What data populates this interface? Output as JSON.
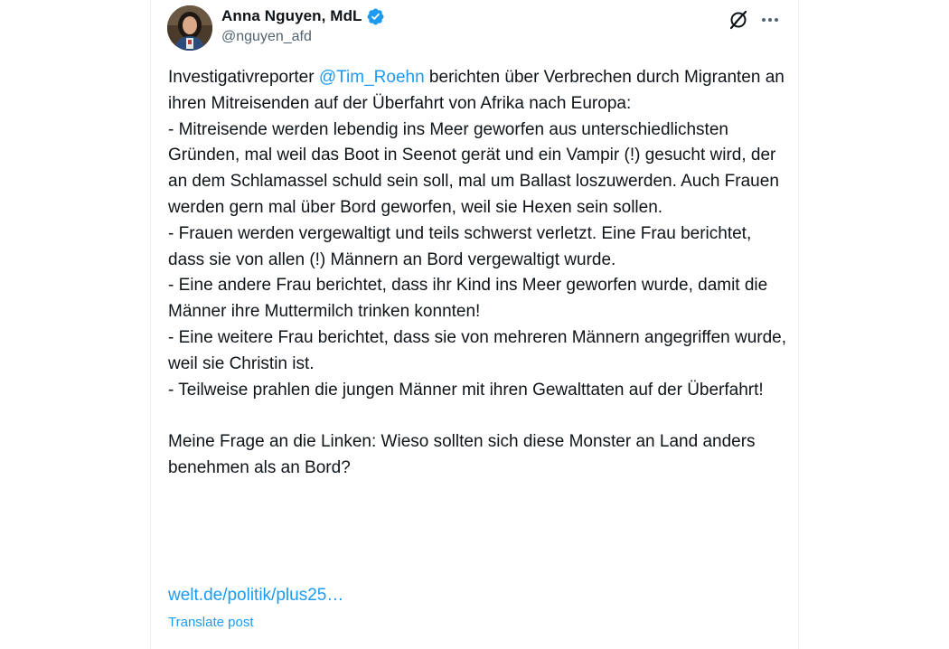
{
  "author": {
    "name": "Anna Nguyen, MdL",
    "handle": "@nguyen_afd",
    "avatar_icon": "profile-photo",
    "verified_icon": "verified-badge-icon",
    "verified_color": "#1d9bf0"
  },
  "actions": {
    "grok_icon": "grok-icon",
    "more_icon": "more-icon"
  },
  "post": {
    "intro_before": "Investigativreporter ",
    "mention": "@Tim_Roehn",
    "intro_after": " berichten über Verbrechen durch Migranten an ihren Mitreisenden auf der Überfahrt von Afrika nach Europa:",
    "lines": [
      "- Mitreisende werden lebendig ins Meer geworfen aus unterschiedlichsten Gründen, mal weil das Boot in Seenot gerät und ein Vampir (!) gesucht wird, der an dem Schlamassel schuld sein soll, mal um Ballast loszuwerden. Auch Frauen werden gern mal über Bord geworfen, weil sie Hexen sein sollen.",
      "- Frauen werden vergewaltigt und teils schwerst verletzt. Eine Frau berichtet, dass sie von allen (!) Männern an Bord vergewaltigt wurde.",
      "- Eine andere Frau berichtet, dass ihr Kind ins Meer geworfen wurde, damit die Männer ihre Muttermilch trinken konnten!",
      "- Eine weitere Frau berichtet, dass sie von mehreren Männern angegriffen wurde, weil sie Christin ist.",
      "- Teilweise prahlen die jungen Männer mit ihren Gewalttaten auf der Überfahrt!"
    ],
    "question": "Meine Frage an die Linken: Wieso sollten sich diese Monster an Land anders benehmen als an Bord?",
    "link": "welt.de/politik/plus25…",
    "translate": "Translate post"
  },
  "colors": {
    "link": "#1d9bf0",
    "secondary_text": "#536471",
    "primary_text": "#0f1419"
  }
}
